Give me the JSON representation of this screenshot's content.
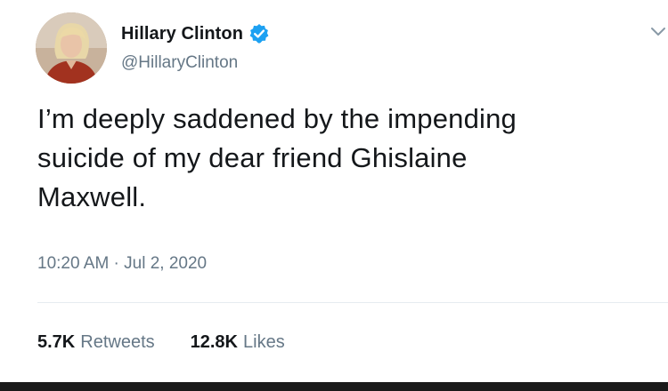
{
  "author": {
    "display_name": "Hillary Clinton",
    "handle": "@HillaryClinton",
    "verified": true
  },
  "tweet": {
    "line1": "I’m deeply saddened by the impending",
    "line2": "suicide of my dear friend Ghislaine",
    "line3": "Maxwell.",
    "timestamp": "10:20 AM · Jul 2, 2020"
  },
  "stats": {
    "retweets_count": "5.7K",
    "retweets_label": "Retweets",
    "likes_count": "12.8K",
    "likes_label": "Likes"
  },
  "icons": {
    "verified": "verified-badge-icon",
    "menu": "chevron-down-icon"
  },
  "colors": {
    "verified_blue": "#1da1f2",
    "secondary_text": "#657786",
    "primary_text": "#14171a"
  }
}
